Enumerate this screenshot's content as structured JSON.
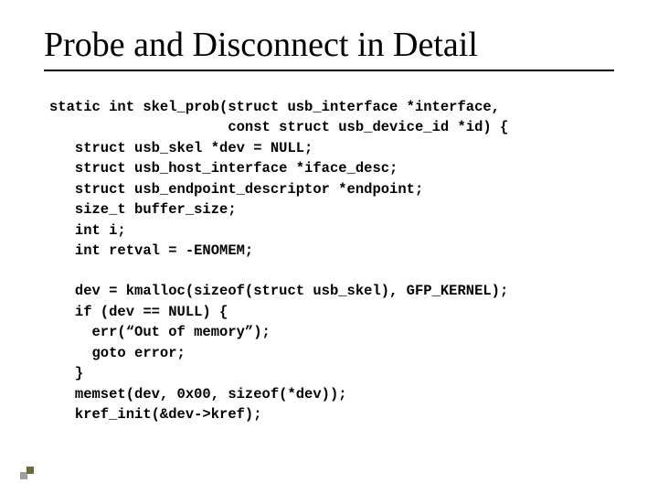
{
  "title": "Probe and Disconnect in Detail",
  "code": {
    "l1": "static int skel_prob(struct usb_interface *interface,",
    "l2": "                     const struct usb_device_id *id) {",
    "l3": "   struct usb_skel *dev = NULL;",
    "l4": "   struct usb_host_interface *iface_desc;",
    "l5": "   struct usb_endpoint_descriptor *endpoint;",
    "l6": "   size_t buffer_size;",
    "l7": "   int i;",
    "l8": "   int retval = -ENOMEM;",
    "l9": "   dev = kmalloc(sizeof(struct usb_skel), GFP_KERNEL);",
    "l10": "   if (dev == NULL) {",
    "l11": "     err(“Out of memory”);",
    "l12": "     goto error;",
    "l13": "   }",
    "l14": "   memset(dev, 0x00, sizeof(*dev));",
    "l15": "   kref_init(&dev->kref);"
  }
}
